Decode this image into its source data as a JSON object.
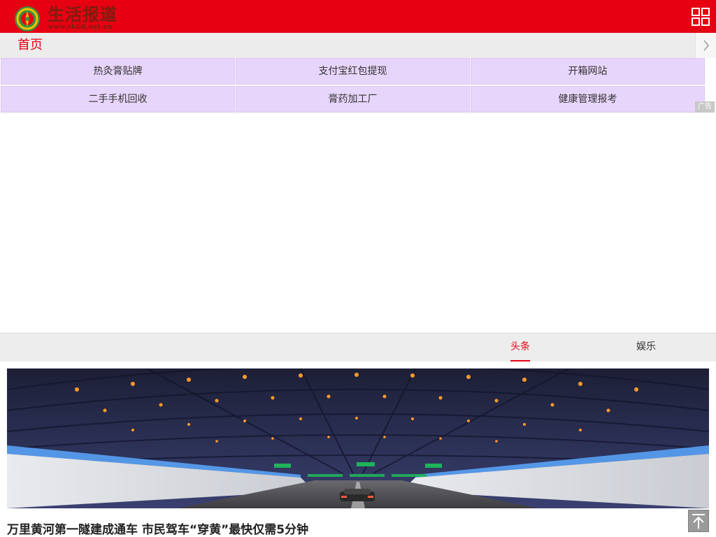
{
  "header": {
    "logo_text": "生活报道",
    "logo_url_text": "www.shbd.net.cn",
    "menu_icon": "grid-menu-icon",
    "accent_color": "#e60012"
  },
  "nav": {
    "home_label": "首页",
    "next_icon": "chevron-right-icon"
  },
  "ads": {
    "items": [
      "热灸膏贴牌",
      "支付宝红包提现",
      "开箱网站",
      "二手手机回收",
      "膏药加工厂",
      "健康管理报考"
    ],
    "badge": "广告",
    "background_color": "#e8d5fb"
  },
  "tabs": [
    {
      "label": "头条",
      "active": true
    },
    {
      "label": "娱乐",
      "active": false
    }
  ],
  "feed": {
    "hero_image": "tunnel-photo",
    "headline": "万里黄河第一隧建成通车 市民驾车“穿黄”最快仅需5分钟"
  },
  "back_to_top_icon": "arrow-up-icon"
}
